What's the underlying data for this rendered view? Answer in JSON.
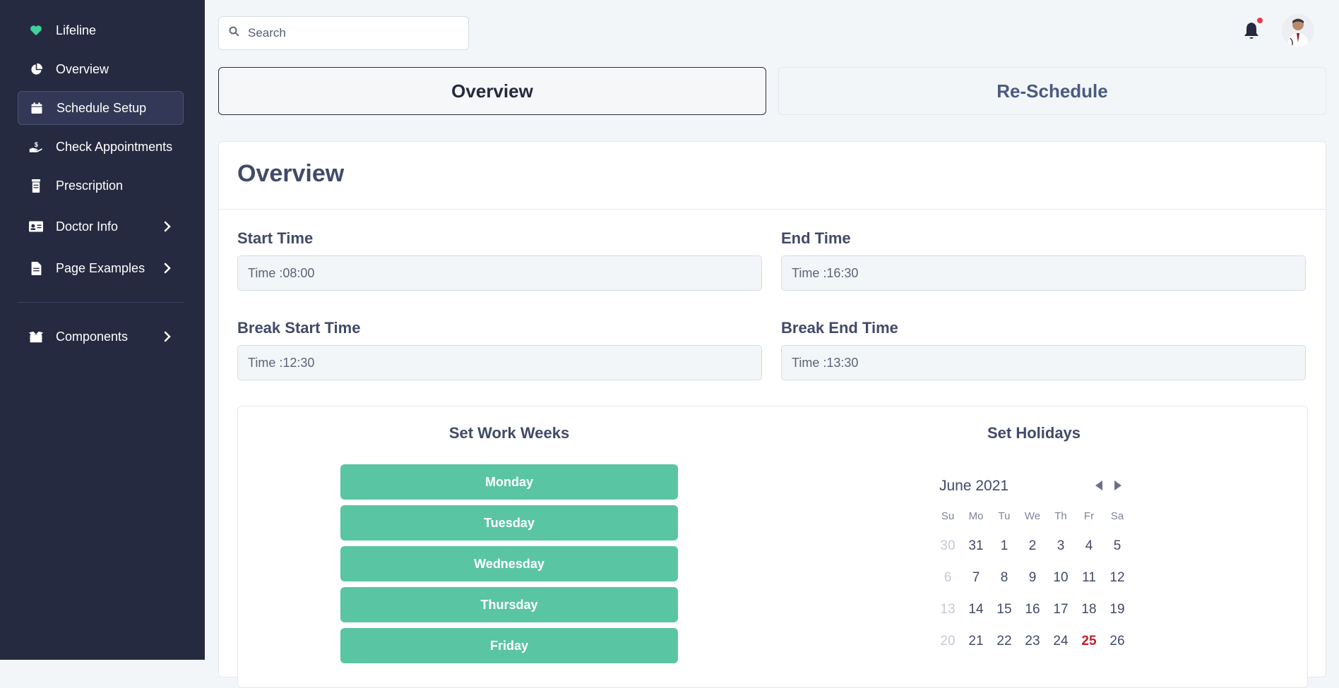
{
  "sidebar": {
    "items": [
      {
        "label": "Lifeline",
        "icon": "heart-icon"
      },
      {
        "label": "Overview",
        "icon": "pie-chart-icon"
      },
      {
        "label": "Schedule Setup",
        "icon": "calendar-icon",
        "active": true
      },
      {
        "label": "Check Appointments",
        "icon": "hand-dollar-icon"
      },
      {
        "label": "Prescription",
        "icon": "document-icon"
      },
      {
        "label": "Doctor Info",
        "icon": "id-card-icon",
        "expandable": true
      },
      {
        "label": "Page Examples",
        "icon": "file-icon",
        "expandable": true
      },
      {
        "label": "Components",
        "icon": "boxes-icon",
        "expandable": true
      }
    ]
  },
  "header": {
    "search_placeholder": "Search",
    "notification_icon": "bell-icon",
    "has_unread": true
  },
  "tabs": [
    {
      "label": "Overview",
      "active": true
    },
    {
      "label": "Re-Schedule",
      "active": false
    }
  ],
  "card": {
    "title": "Overview",
    "fields": {
      "start_time": {
        "label": "Start Time",
        "value": "Time :08:00"
      },
      "end_time": {
        "label": "End Time",
        "value": "Time :16:30"
      },
      "break_start": {
        "label": "Break Start Time",
        "value": "Time :12:30"
      },
      "break_end": {
        "label": "Break End Time",
        "value": "Time :13:30"
      }
    },
    "work_weeks": {
      "title": "Set Work Weeks",
      "days": [
        "Monday",
        "Tuesday",
        "Wednesday",
        "Thursday",
        "Friday"
      ]
    },
    "holidays": {
      "title": "Set Holidays",
      "month": "June 2021",
      "weekdays": [
        "Su",
        "Mo",
        "Tu",
        "We",
        "Th",
        "Fr",
        "Sa"
      ],
      "weeks": [
        [
          "30",
          "31",
          "1",
          "2",
          "3",
          "4",
          "5"
        ],
        [
          "6",
          "7",
          "8",
          "9",
          "10",
          "11",
          "12"
        ],
        [
          "13",
          "14",
          "15",
          "16",
          "17",
          "18",
          "19"
        ],
        [
          "20",
          "21",
          "22",
          "23",
          "24",
          "25",
          "26"
        ]
      ],
      "muted_days": [
        "30",
        "6",
        "13",
        "20"
      ],
      "highlighted_day": "25"
    }
  },
  "colors": {
    "sidebar_bg": "#262a40",
    "accent_green": "#5ac5a2",
    "heading": "#414a68",
    "holiday_red": "#c0202b"
  }
}
